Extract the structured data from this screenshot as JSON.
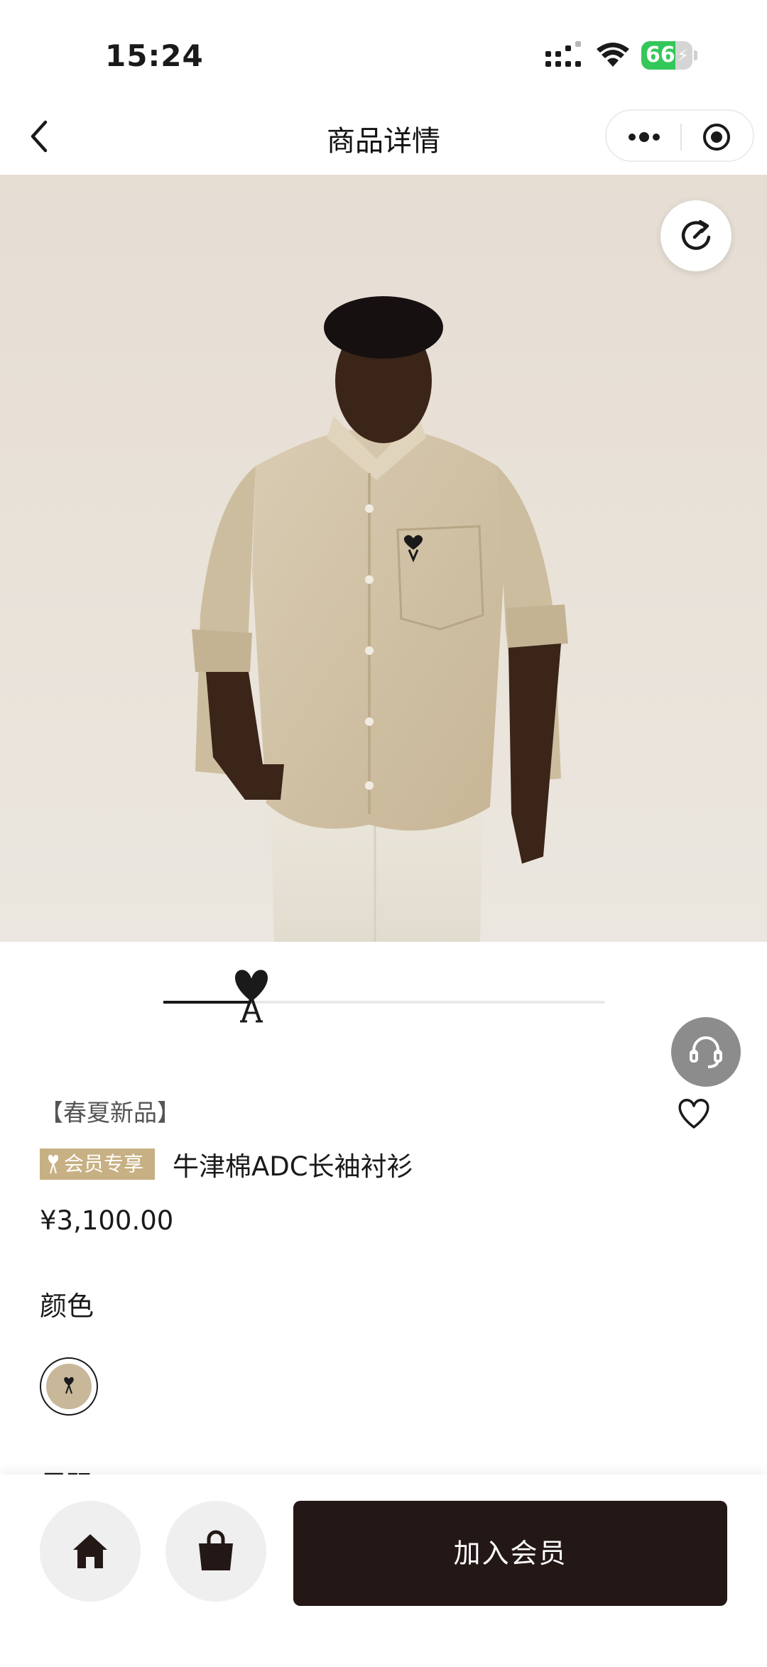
{
  "status_bar": {
    "time": "15:24",
    "battery": "66",
    "battery_level": 0.66
  },
  "nav": {
    "title": "商品详情",
    "back_icon": "chevron-left-icon",
    "more_icon": "more-dots-icon",
    "target_icon": "target-icon"
  },
  "gallery": {
    "slide_progress": 0.2,
    "image_label": "Model wearing beige oxford shirt with heart logo and cream trousers"
  },
  "product": {
    "tag": "【春夏新品】",
    "badge": "会员专享",
    "name": "牛津棉ADC长袖衬衫",
    "price": "¥3,100.00"
  },
  "options": {
    "color_label": "颜色",
    "next_label": "尺码",
    "selected_color": "#c9b79a"
  },
  "actions": {
    "join_label": "加入会员",
    "home_icon": "home-icon",
    "bag_icon": "shopping-bag-icon"
  },
  "colors": {
    "accent_gold": "#c7b083",
    "dark_button": "#231816",
    "battery_green": "#34c759"
  }
}
